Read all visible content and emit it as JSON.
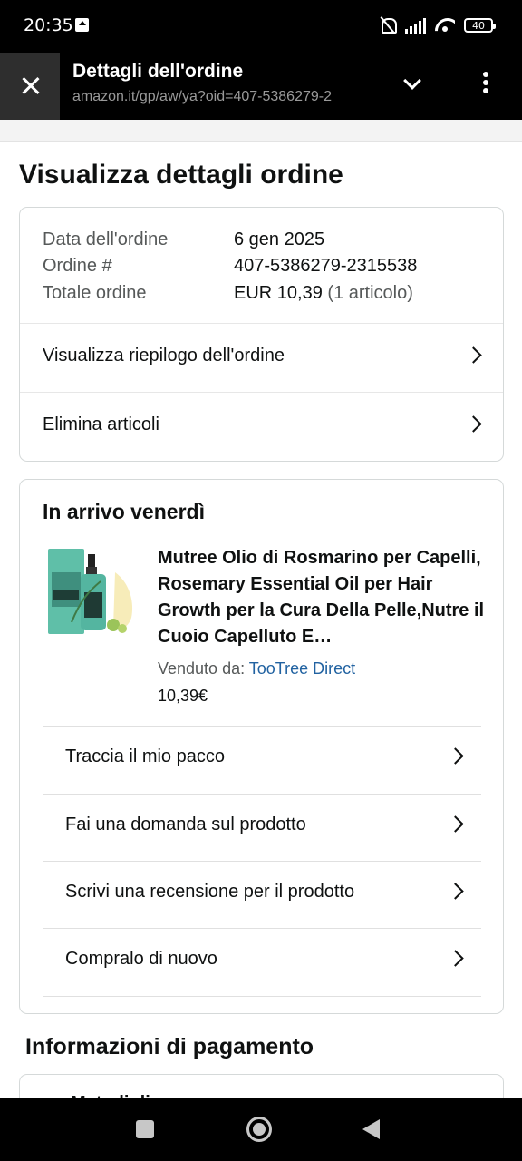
{
  "status_bar": {
    "time": "20:35",
    "battery": "40"
  },
  "browser": {
    "title": "Dettagli dell'ordine",
    "url": "amazon.it/gp/aw/ya?oid=407-5386279-2"
  },
  "page": {
    "title": "Visualizza dettagli ordine"
  },
  "order_info": {
    "rows": [
      {
        "label": "Data dell'ordine",
        "value": "6 gen 2025"
      },
      {
        "label": "Ordine #",
        "value": "407-5386279-2315538"
      },
      {
        "label": "Totale ordine",
        "value": "EUR 10,39",
        "extra": "(1 articolo)"
      }
    ],
    "links": [
      {
        "label": "Visualizza riepilogo dell'ordine"
      },
      {
        "label": "Elimina articoli"
      }
    ]
  },
  "shipment": {
    "heading": "In arrivo venerdì",
    "product": {
      "title": "Mutree Olio di Rosmarino per Capelli, Rosemary Essential Oil per Hair Growth per la Cura Della Pelle,Nutre il Cuoio Capelluto E…",
      "sold_by_label": "Venduto da:",
      "seller": "TooTree Direct",
      "price": "10,39€"
    },
    "actions": [
      {
        "label": "Traccia il mio pacco"
      },
      {
        "label": "Fai una domanda sul prodotto"
      },
      {
        "label": "Scrivi una recensione per il prodotto"
      },
      {
        "label": "Compralo di nuovo"
      }
    ]
  },
  "payment": {
    "title": "Informazioni di pagamento",
    "partial_text": "Metodi di"
  },
  "colors": {
    "link": "#2162a1",
    "border": "#d5d9d9",
    "bottle_green": "#5fbfa8"
  }
}
